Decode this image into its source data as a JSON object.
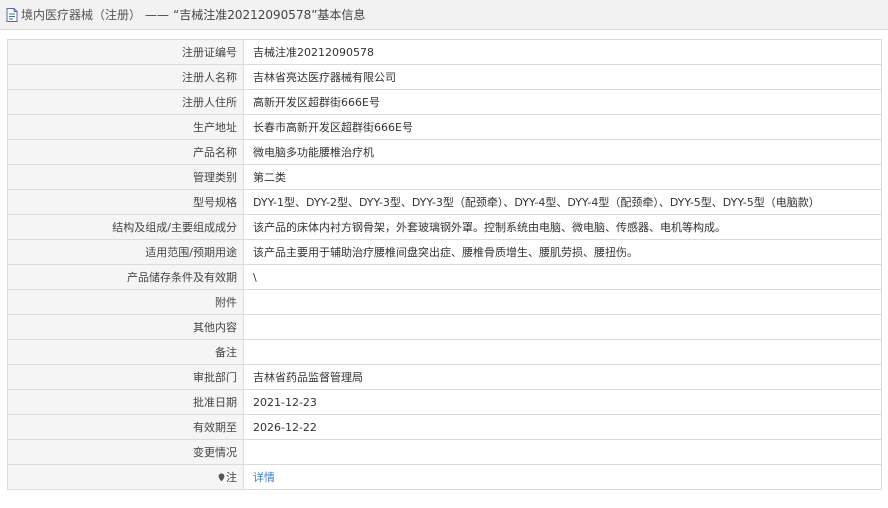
{
  "header": {
    "prefix": "境内医疗器械（注册）",
    "separator": "——",
    "title": "“吉械注准20212090578”基本信息"
  },
  "rows": [
    {
      "label": "注册证编号",
      "value": "吉械注准20212090578"
    },
    {
      "label": "注册人名称",
      "value": "吉林省亮达医疗器械有限公司"
    },
    {
      "label": "注册人住所",
      "value": "高新开发区超群街666E号"
    },
    {
      "label": "生产地址",
      "value": "长春市高新开发区超群街666E号"
    },
    {
      "label": "产品名称",
      "value": "微电脑多功能腰椎治疗机"
    },
    {
      "label": "管理类别",
      "value": "第二类"
    },
    {
      "label": "型号规格",
      "value": "DYY-1型、DYY-2型、DYY-3型、DYY-3型（配颈牵）、DYY-4型、DYY-4型（配颈牵）、DYY-5型、DYY-5型（电脑款）"
    },
    {
      "label": "结构及组成/主要组成成分",
      "value": "该产品的床体内衬方钢骨架，外套玻璃钢外罩。控制系统由电脑、微电脑、传感器、电机等构成。"
    },
    {
      "label": "适用范围/预期用途",
      "value": "该产品主要用于辅助治疗腰椎间盘突出症、腰椎骨质增生、腰肌劳损、腰扭伤。"
    },
    {
      "label": "产品储存条件及有效期",
      "value": "\\"
    },
    {
      "label": "附件",
      "value": ""
    },
    {
      "label": "其他内容",
      "value": ""
    },
    {
      "label": "备注",
      "value": ""
    },
    {
      "label": "审批部门",
      "value": "吉林省药品监督管理局"
    },
    {
      "label": "批准日期",
      "value": "2021-12-23"
    },
    {
      "label": "有效期至",
      "value": "2026-12-22"
    },
    {
      "label": "变更情况",
      "value": ""
    }
  ],
  "note": {
    "label": "注",
    "link_text": "详情"
  }
}
